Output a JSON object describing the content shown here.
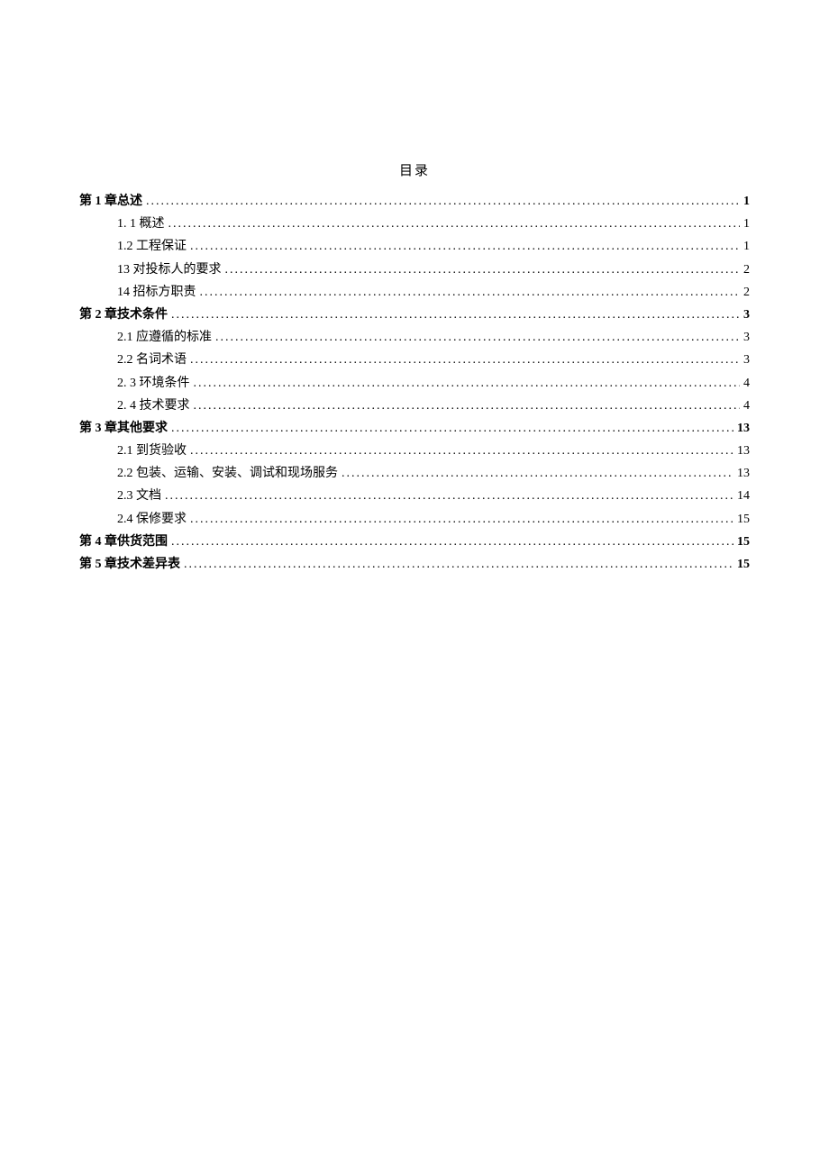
{
  "title": "目录",
  "entries": [
    {
      "level": 0,
      "label": "第 1 章总述",
      "page": "1",
      "bold": true
    },
    {
      "level": 1,
      "label": "1.   1 概述",
      "page": "1",
      "bold": false
    },
    {
      "level": 1,
      "label": "1.2 工程保证",
      "page": "1",
      "bold": false
    },
    {
      "level": 1,
      "label": "13 对投标人的要求",
      "page": "2",
      "bold": false
    },
    {
      "level": 1,
      "label": "14 招标方职责",
      "page": "2",
      "bold": false
    },
    {
      "level": 0,
      "label": "第 2 章技术条件",
      "page": "3",
      "bold": true
    },
    {
      "level": 1,
      "label": "2.1 应遵循的标准",
      "page": "3",
      "bold": false
    },
    {
      "level": 1,
      "label": "2.2 名词术语",
      "page": "3",
      "bold": false
    },
    {
      "level": 1,
      "label": "2.   3 环境条件",
      "page": "4",
      "bold": false
    },
    {
      "level": 1,
      "label": "2.   4 技术要求",
      "page": "4",
      "bold": false
    },
    {
      "level": 0,
      "label": "第 3 章其他要求",
      "page": "13",
      "bold": true
    },
    {
      "level": 1,
      "label": "2.1    到货验收",
      "page": "13",
      "bold": false
    },
    {
      "level": 1,
      "label": "2.2    包装、运输、安装、调试和现场服务",
      "page": "13",
      "bold": false
    },
    {
      "level": 1,
      "label": "2.3    文档",
      "page": "14",
      "bold": false
    },
    {
      "level": 1,
      "label": "2.4    保修要求",
      "page": "15",
      "bold": false
    },
    {
      "level": 0,
      "label": "第 4 章供货范围",
      "page": "15",
      "bold": true
    },
    {
      "level": 0,
      "label": "第 5 章技术差异表",
      "page": "15",
      "bold": true
    }
  ]
}
